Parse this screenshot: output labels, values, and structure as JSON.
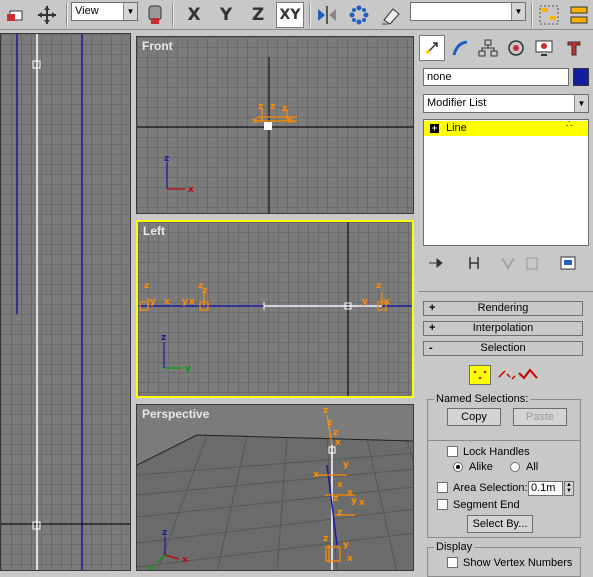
{
  "toolbar": {
    "reference_dropdown": "View",
    "axis_x": "X",
    "axis_y": "Y",
    "axis_z": "Z",
    "axis_xy": "XY",
    "named_selection_dropdown": ""
  },
  "viewports": {
    "front": {
      "label": "Front"
    },
    "left": {
      "label": "Left"
    },
    "perspective": {
      "label": "Perspective"
    }
  },
  "panel": {
    "object_name": "none",
    "object_color": "#0f1fa0",
    "modifier_list": "Modifier List",
    "stack_item": "Line",
    "rollouts": {
      "rendering": "Rendering",
      "interpolation": "Interpolation",
      "selection": "Selection",
      "rendering_sign": "+",
      "interpolation_sign": "+",
      "selection_sign": "-"
    },
    "named_selections": {
      "title": "Named Selections:",
      "copy": "Copy",
      "paste": "Paste"
    },
    "lock_handles": "Lock Handles",
    "alike": "Alike",
    "all": "All",
    "area_selection": "Area Selection:",
    "area_value": "0.1m",
    "segment_end": "Segment End",
    "select_by": "Select By...",
    "display": {
      "title": "Display",
      "show_vertex_numbers": "Show Vertex Numbers"
    }
  },
  "colors": {
    "active_viewport": "#ffff00",
    "selection_highlight": "#ffff00",
    "gizmo": "#ff8c00"
  }
}
